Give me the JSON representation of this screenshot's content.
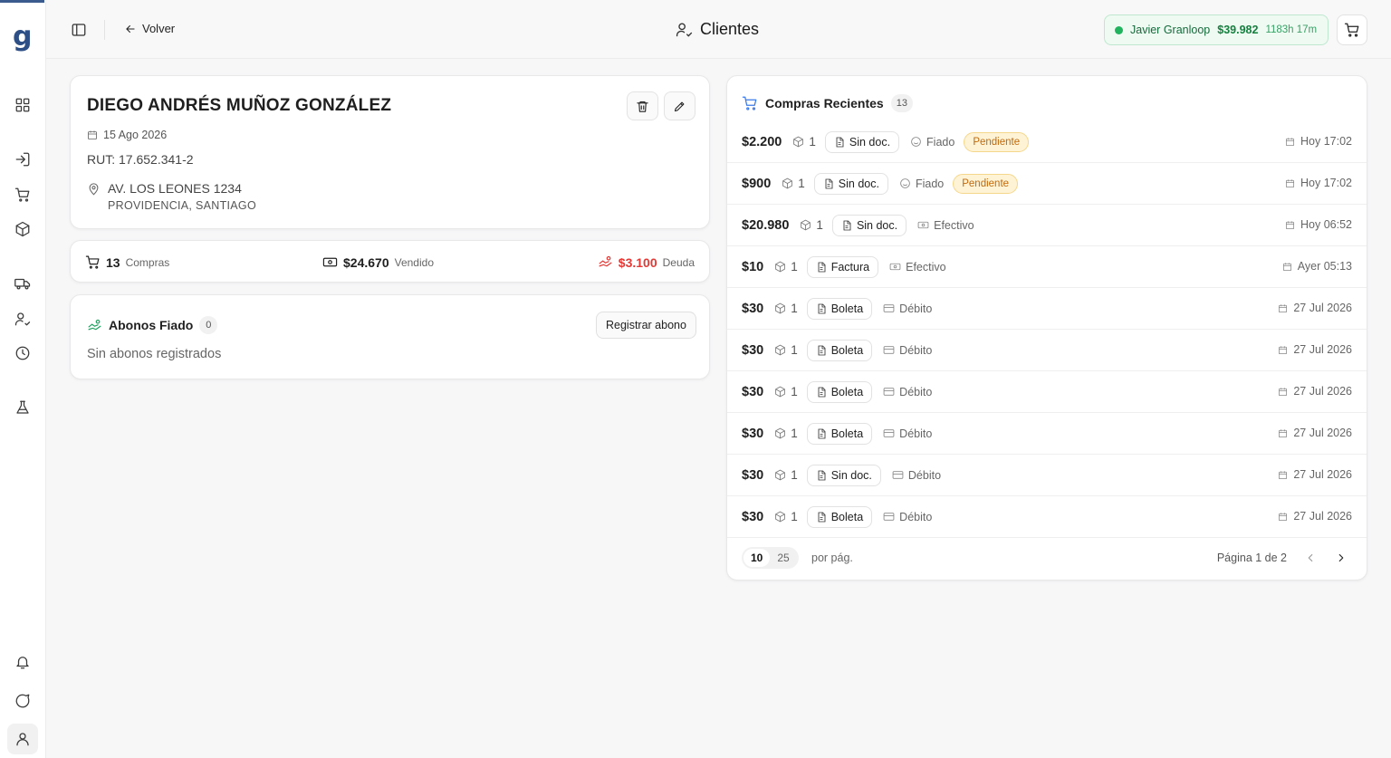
{
  "app": {
    "logo": "g"
  },
  "header": {
    "back_label": "Volver",
    "title": "Clientes",
    "session": {
      "user": "Javier Granloop",
      "amount": "$39.982",
      "time": "1183h 17m"
    }
  },
  "client": {
    "name": "DIEGO ANDRÉS MUÑOZ GONZÁLEZ",
    "date": "15 Ago 2026",
    "rut": "RUT: 17.652.341-2",
    "address_line1": "AV. LOS LEONES 1234",
    "address_line2": "PROVIDENCIA, SANTIAGO"
  },
  "stats": {
    "compras_num": "13",
    "compras_label": "Compras",
    "vendido_num": "$24.670",
    "vendido_label": "Vendido",
    "deuda_num": "$3.100",
    "deuda_label": "Deuda"
  },
  "abonos": {
    "title": "Abonos Fiado",
    "count": "0",
    "register_label": "Registrar abono",
    "empty": "Sin abonos registrados"
  },
  "purchases": {
    "title": "Compras Recientes",
    "count": "13",
    "rows": [
      {
        "amount": "$2.200",
        "qty": "1",
        "doc": "Sin doc.",
        "payment": "Fiado",
        "status": "Pendiente",
        "date": "Hoy 17:02"
      },
      {
        "amount": "$900",
        "qty": "1",
        "doc": "Sin doc.",
        "payment": "Fiado",
        "status": "Pendiente",
        "date": "Hoy 17:02"
      },
      {
        "amount": "$20.980",
        "qty": "1",
        "doc": "Sin doc.",
        "payment": "Efectivo",
        "status": "",
        "date": "Hoy 06:52"
      },
      {
        "amount": "$10",
        "qty": "1",
        "doc": "Factura",
        "payment": "Efectivo",
        "status": "",
        "date": "Ayer 05:13"
      },
      {
        "amount": "$30",
        "qty": "1",
        "doc": "Boleta",
        "payment": "Débito",
        "status": "",
        "date": "27 Jul 2026"
      },
      {
        "amount": "$30",
        "qty": "1",
        "doc": "Boleta",
        "payment": "Débito",
        "status": "",
        "date": "27 Jul 2026"
      },
      {
        "amount": "$30",
        "qty": "1",
        "doc": "Boleta",
        "payment": "Débito",
        "status": "",
        "date": "27 Jul 2026"
      },
      {
        "amount": "$30",
        "qty": "1",
        "doc": "Boleta",
        "payment": "Débito",
        "status": "",
        "date": "27 Jul 2026"
      },
      {
        "amount": "$30",
        "qty": "1",
        "doc": "Sin doc.",
        "payment": "Débito",
        "status": "",
        "date": "27 Jul 2026"
      },
      {
        "amount": "$30",
        "qty": "1",
        "doc": "Boleta",
        "payment": "Débito",
        "status": "",
        "date": "27 Jul 2026"
      }
    ],
    "page_sizes": [
      "10",
      "25"
    ],
    "page_size_selected": "10",
    "per_page_label": "por pág.",
    "page_info": "Página 1 de 2"
  },
  "colors": {
    "brand": "#2d4f86",
    "success": "#22b35e",
    "debt": "#e53935",
    "pending": "#c06a0c",
    "accent": "#3b7be8"
  }
}
